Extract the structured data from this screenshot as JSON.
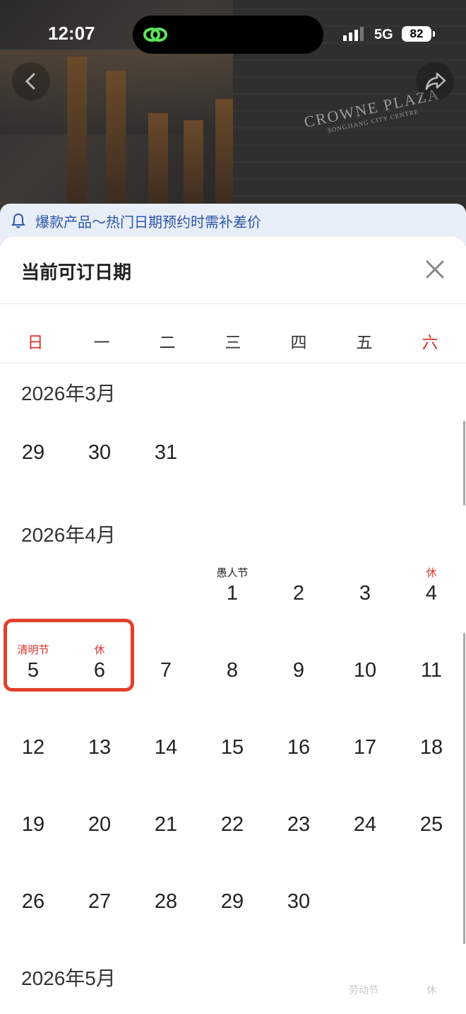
{
  "status": {
    "time": "12:07",
    "network": "5G",
    "battery": "82"
  },
  "hero": {
    "logo_main": "CROWNE PLAZA",
    "logo_sub": "SONGJIANG CITY CENTRE"
  },
  "banner": {
    "text": "爆款产品～热门日期预约时需补差价"
  },
  "sheet": {
    "title": "当前可订日期"
  },
  "weekdays": [
    "日",
    "一",
    "二",
    "三",
    "四",
    "五",
    "六"
  ],
  "months": [
    {
      "title": "2026年3月"
    },
    {
      "title": "2026年4月"
    },
    {
      "title": "2026年5月"
    }
  ],
  "march_days": [
    "29",
    "30",
    "31"
  ],
  "april": {
    "row1": [
      "1",
      "2",
      "3",
      "4"
    ],
    "row1_labels": {
      "d1": "愚人节",
      "d4": "休"
    },
    "row2": [
      "5",
      "6",
      "7",
      "8",
      "9",
      "10",
      "11"
    ],
    "row2_labels": {
      "d5": "清明节",
      "d6": "休"
    },
    "row3": [
      "12",
      "13",
      "14",
      "15",
      "16",
      "17",
      "18"
    ],
    "row4": [
      "19",
      "20",
      "21",
      "22",
      "23",
      "24",
      "25"
    ],
    "row5": [
      "26",
      "27",
      "28",
      "29",
      "30"
    ]
  },
  "may_preview_labels": [
    "劳动节",
    "休"
  ],
  "colors": {
    "weekend_red": "#e0312b",
    "banner_blue": "#2b55a8",
    "highlight": "#e2412b"
  }
}
